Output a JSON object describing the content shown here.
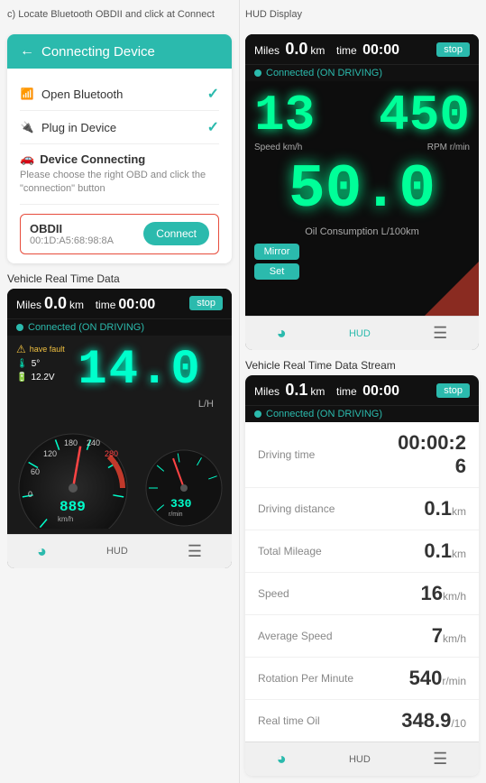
{
  "top_labels": {
    "c_label": "c)  Locate Bluetooth OBDII and click at Connect",
    "hud_label": "HUD Display"
  },
  "connect_device": {
    "header": "Connecting Device",
    "step1": {
      "icon": "bluetooth",
      "label": "Open Bluetooth",
      "checked": true
    },
    "step2": {
      "icon": "plug",
      "label": "Plug in Device",
      "checked": true
    },
    "step3_title": "Device Connecting",
    "step3_sub": "Please choose the right OBD and click the \"connection\" button",
    "obd_name": "OBDII",
    "obd_mac": "00:1D:A5:68:98:8A",
    "connect_btn": "Connect"
  },
  "vehicle_left": {
    "section_label": "Vehicle Real Time Data",
    "miles_prefix": "Miles",
    "miles_value": "0.0",
    "miles_unit": "km",
    "time_prefix": "time",
    "time_value": "00:00",
    "stop_btn": "stop",
    "status": "Connected (ON DRIVING)",
    "have_fault": "have fault",
    "temp": "5°",
    "volt": "12.2V",
    "big_number": "14.0",
    "lph": "L/H",
    "speedo_value": "889",
    "speedo_unit": "km/h",
    "tach_value": "330",
    "tach_unit": "r/min"
  },
  "left_bottom_nav": {
    "item1_icon": "⊙",
    "item2_label": "HUD",
    "item3_icon": "☰"
  },
  "hud_display": {
    "header_label": "HUD Display",
    "miles_value": "0.0",
    "miles_unit": "km",
    "time_value": "00:00",
    "stop_btn": "stop",
    "status": "Connected (ON DRIVING)",
    "big_left": "13",
    "sub_left": "Speed km/h",
    "big_right": "450",
    "sub_right": "RPM r/min",
    "center_num": "50.0",
    "center_sub": "Oil Consumption L/100km",
    "btn1": "Mirror",
    "btn2": "Set"
  },
  "hud_bottom_nav": {
    "item1_icon": "⊙",
    "item2_label": "HUD",
    "item3_icon": "☰"
  },
  "stream": {
    "section_label": "Vehicle Real Time Data Stream",
    "miles_value": "0.1",
    "miles_unit": "km",
    "time_value": "00:00",
    "stop_btn": "stop",
    "status": "Connected (ON DRIVING)",
    "rows": [
      {
        "label": "Driving time",
        "value": "00:00:2",
        "value2": "6",
        "unit": ""
      },
      {
        "label": "Driving distance",
        "value": "0.1",
        "unit": "km"
      },
      {
        "label": "Total Mileage",
        "value": "0.1",
        "unit": "km"
      },
      {
        "label": "Speed",
        "value": "16",
        "unit": "km/h"
      },
      {
        "label": "Average Speed",
        "value": "7",
        "unit": "km/h"
      },
      {
        "label": "Rotation Per Minute",
        "value": "540",
        "unit": "r/min"
      },
      {
        "label": "Real time Oil",
        "value": "348.9",
        "unit": "/10"
      }
    ]
  },
  "stream_bottom_nav": {
    "item1_icon": "⊙",
    "item2_label": "HUD",
    "item3_icon": "☰"
  }
}
